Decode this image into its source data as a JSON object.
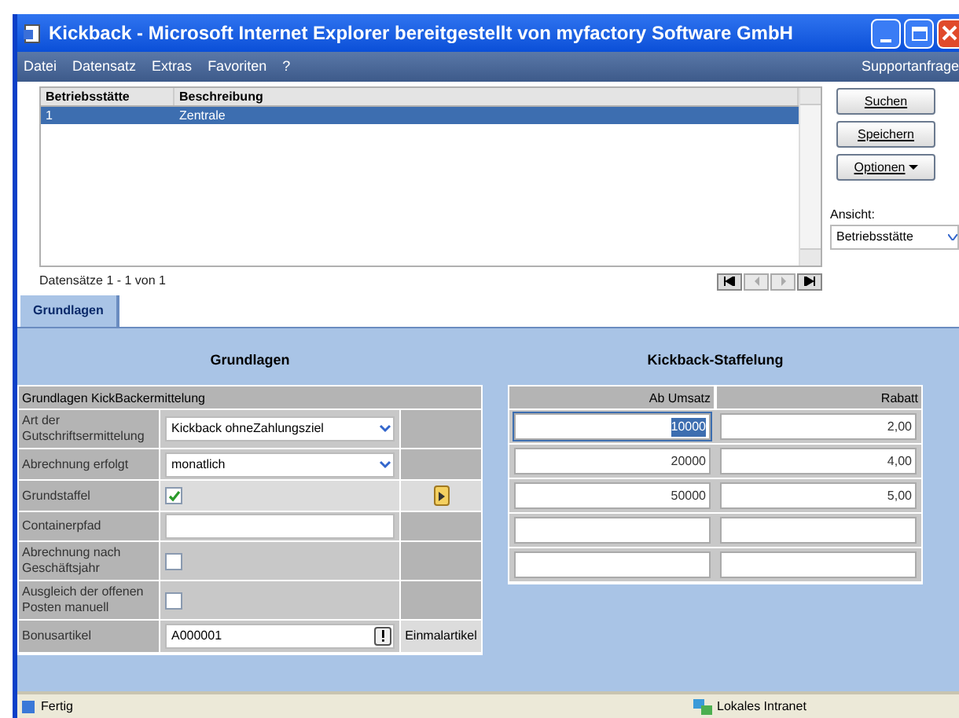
{
  "window": {
    "title": "Kickback - Microsoft Internet Explorer bereitgestellt von myfactory Software GmbH"
  },
  "menu": [
    "Datei",
    "Datensatz",
    "Extras",
    "Favoriten",
    "?"
  ],
  "support_link": "Supportanfrage",
  "list": {
    "columns": [
      "Betriebsstätte",
      "Beschreibung"
    ],
    "rows": [
      {
        "cells": [
          "1",
          "Zentrale"
        ],
        "selected": true
      }
    ],
    "record_count": "Datensätze 1 - 1 von 1"
  },
  "buttons": [
    "Suchen",
    "Speichern",
    "Optionen"
  ],
  "view": {
    "label": "Ansicht:",
    "value": "Betriebsstätte"
  },
  "tabs": [
    {
      "label": "Grundlagen",
      "selected": true
    }
  ],
  "grundlagen": {
    "heading": "Grundlagen",
    "table_title": "Grundlagen KickBackermittelung",
    "rows": [
      {
        "kind": "select",
        "label": "Art der Gutschriftsermittelung",
        "value": "Kickback ohneZahlungsziel"
      },
      {
        "kind": "select",
        "label": "Abrechnung erfolgt",
        "value": "monatlich"
      },
      {
        "kind": "checkbox",
        "label": "Grundstaffel",
        "checked": true
      },
      {
        "kind": "text",
        "label": "Containerpfad"
      },
      {
        "kind": "checkbox",
        "label": "Abrechnung nach Geschäftsjahr",
        "checked": false
      },
      {
        "kind": "checkbox",
        "label": "Ausgleich der offenen Posten manuell",
        "checked": false
      },
      {
        "kind": "lookup",
        "label": "Bonusartikel",
        "value": "A000001",
        "extra": "Einmalartikel"
      }
    ]
  },
  "staffelung": {
    "heading": "Kickback-Staffelung",
    "columns": [
      "Ab Umsatz",
      "Rabatt"
    ],
    "rows": [
      {
        "umsatz": "10000",
        "rabatt": "2,00",
        "selected": true
      },
      {
        "umsatz": "20000",
        "rabatt": "4,00",
        "selected": false
      },
      {
        "umsatz": "50000",
        "rabatt": "5,00",
        "selected": false
      },
      {
        "umsatz": "",
        "rabatt": "",
        "selected": false
      },
      {
        "umsatz": "",
        "rabatt": "",
        "selected": false
      }
    ]
  },
  "status_bar": {
    "left": "Fertig",
    "right": "Lokales Intranet"
  }
}
